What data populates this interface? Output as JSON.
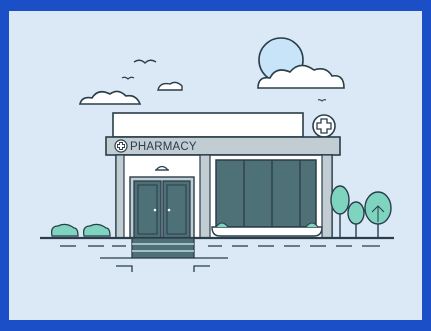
{
  "scene": {
    "sign_text": "PHARMACY"
  },
  "colors": {
    "frame": "#1a4fc7",
    "background": "#dae9f5",
    "outline": "#2a3d4a",
    "window": "#4e7077",
    "signboard": "#c2ccd3",
    "foliage": "#7fd4c0",
    "wall": "#ffffff",
    "sun": "#c7e4f8"
  },
  "icons": {
    "cross": "medical-cross-icon",
    "birds": "bird-icon"
  }
}
